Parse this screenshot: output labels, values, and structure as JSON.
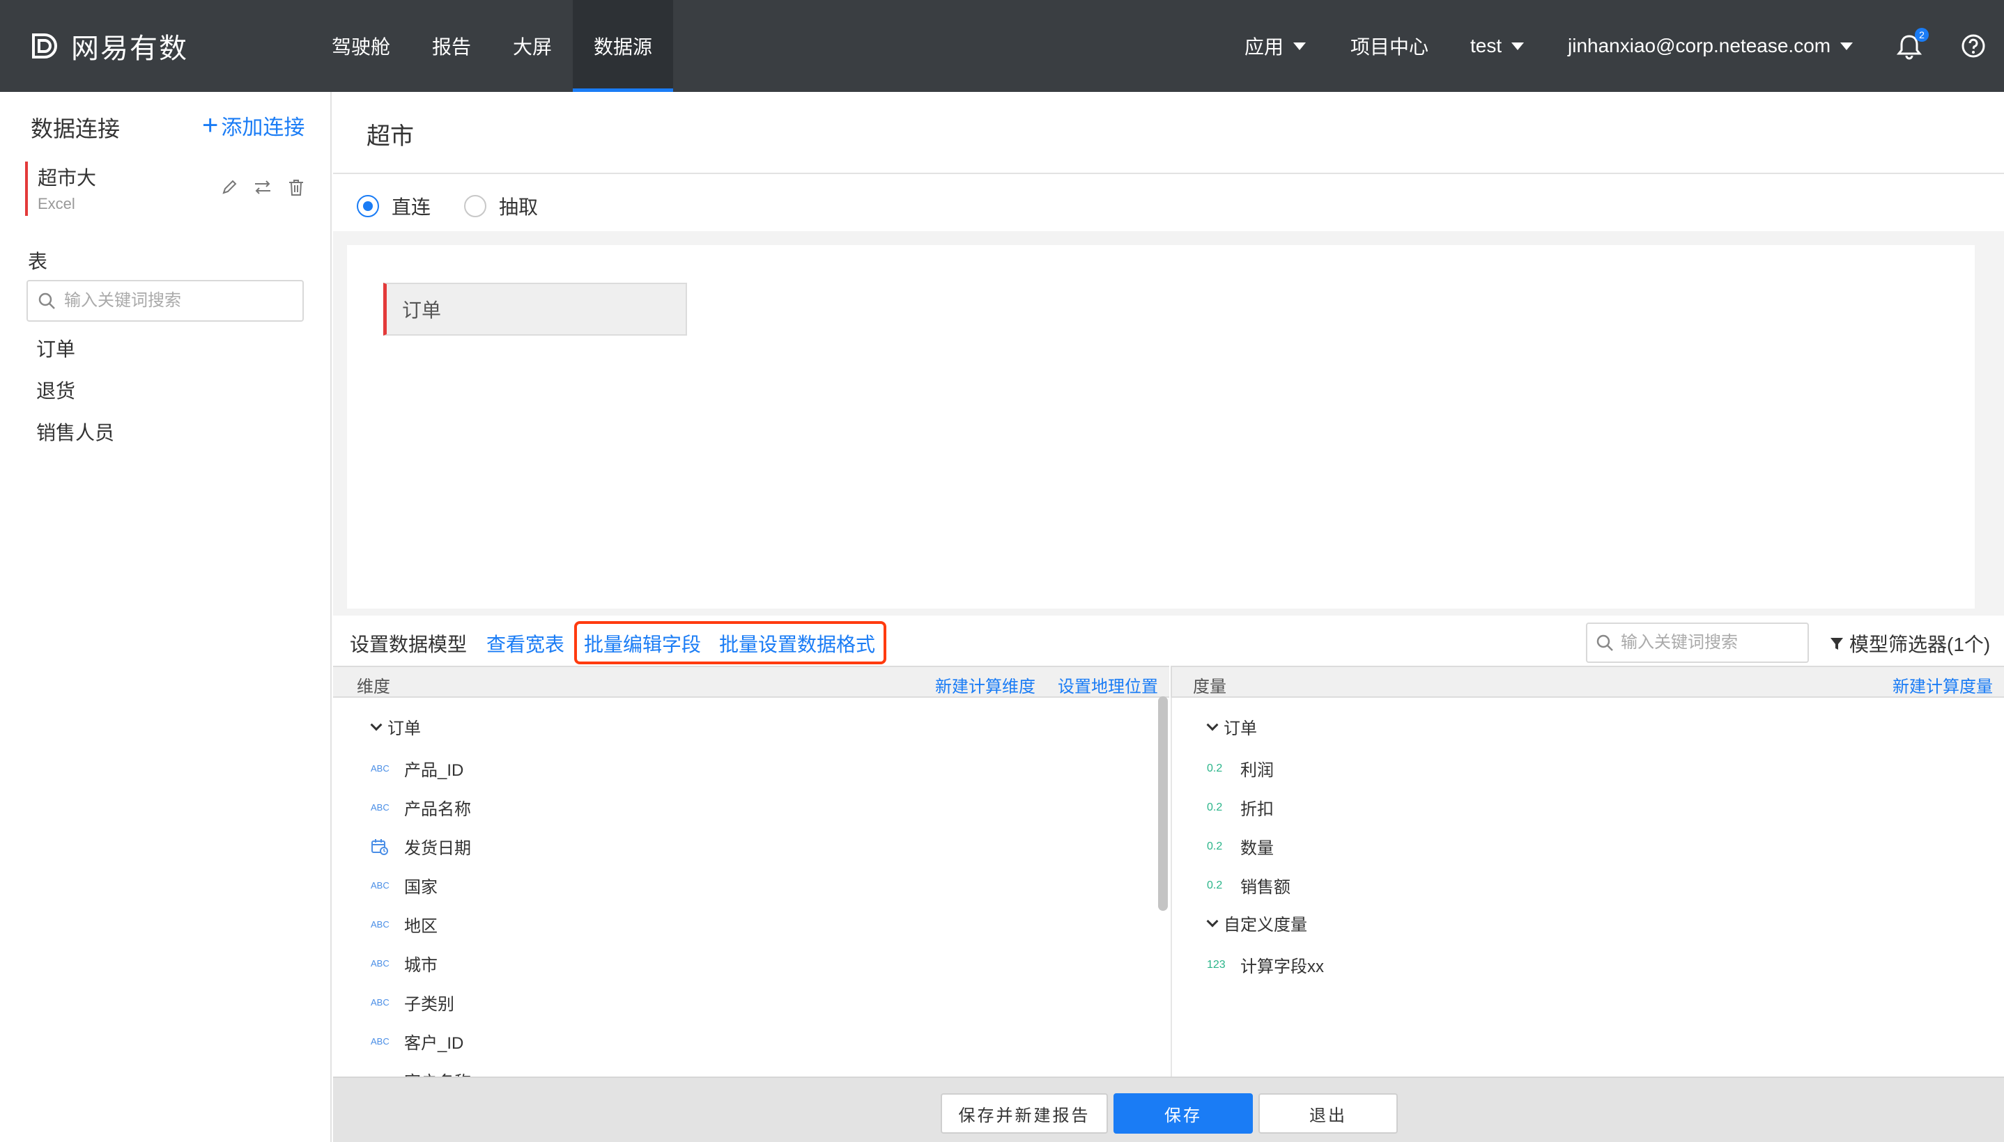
{
  "colors": {
    "nav_bg": "#3a3e42",
    "accent": "#1a7cf5",
    "highlight": "#ff3b0f",
    "marker": "#e33a3a"
  },
  "brand": {
    "name": "网易有数",
    "logo_icon": "netease-youshu-logo"
  },
  "nav": {
    "items": [
      "驾驶舱",
      "报告",
      "大屏",
      "数据源"
    ],
    "active": "数据源",
    "app_menu": "应用",
    "project_center": "项目中心",
    "project": "test",
    "user": "jinhanxiao@corp.netease.com",
    "notification_count": "2"
  },
  "sidebar": {
    "title": "数据连接",
    "add_label": "添加连接",
    "connection": {
      "name": "超市大",
      "type": "Excel"
    },
    "tables_label": "表",
    "search_placeholder": "输入关键词搜索",
    "tables": [
      "订单",
      "退货",
      "销售人员"
    ]
  },
  "main": {
    "title": "超市",
    "modes": [
      "直连",
      "抽取"
    ],
    "selected_mode": "直连",
    "canvas_table": "订单"
  },
  "toolbar": {
    "set_model": "设置数据模型",
    "view_wide": "查看宽表",
    "batch_edit": "批量编辑字段",
    "batch_format": "批量设置数据格式",
    "search_placeholder": "输入关键词搜索",
    "filter": "模型筛选器(1个)"
  },
  "dimensions": {
    "header": "维度",
    "new_calc": "新建计算维度",
    "geo": "设置地理位置",
    "group": "订单",
    "fields": [
      {
        "type": "ABC",
        "name": "产品_ID"
      },
      {
        "type": "ABC",
        "name": "产品名称"
      },
      {
        "type": "date",
        "name": "发货日期"
      },
      {
        "type": "ABC",
        "name": "国家"
      },
      {
        "type": "ABC",
        "name": "地区"
      },
      {
        "type": "ABC",
        "name": "城市"
      },
      {
        "type": "ABC",
        "name": "子类别"
      },
      {
        "type": "ABC",
        "name": "客户_ID"
      },
      {
        "type": "ABC",
        "name": "客户名称"
      }
    ]
  },
  "measures": {
    "header": "度量",
    "new_calc": "新建计算度量",
    "group": "订单",
    "fields": [
      {
        "type": "0.2",
        "name": "利润"
      },
      {
        "type": "0.2",
        "name": "折扣"
      },
      {
        "type": "0.2",
        "name": "数量"
      },
      {
        "type": "0.2",
        "name": "销售额"
      }
    ],
    "custom_group": "自定义度量",
    "custom_fields": [
      {
        "type": "123",
        "name": "计算字段xx"
      }
    ]
  },
  "footer": {
    "save_new_report": "保存并新建报告",
    "save": "保存",
    "exit": "退出"
  }
}
